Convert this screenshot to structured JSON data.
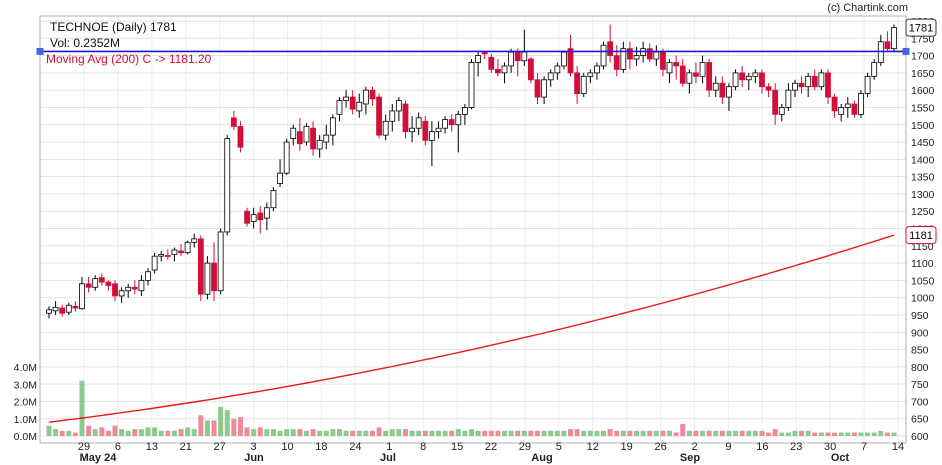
{
  "watermark": "(c) Chartink.com",
  "header": {
    "title": "TECHNOE (Daily) 1781",
    "volume": "Vol: 0.2352M",
    "ma_label": "Moving Avg (200) C -> 1181.20"
  },
  "badges": {
    "last": "1781",
    "ma": "1181"
  },
  "colors": {
    "up": "#ffffff",
    "up_border": "#000000",
    "down": "#d0103a",
    "ma": "#e81c1c",
    "hline": "#1a1ad0",
    "vol_up": "#8ec98e",
    "vol_down": "#ef8a9a",
    "grid": "#e3e3e3"
  },
  "chart_data": {
    "type": "candlestick",
    "title": "TECHNOE (Daily) 1781",
    "price_axis": {
      "min": 600,
      "max": 1800,
      "step": 50,
      "labels": [
        "600",
        "650",
        "700",
        "750",
        "800",
        "850",
        "900",
        "950",
        "1000",
        "1050",
        "1100",
        "1150",
        "1200",
        "1250",
        "1300",
        "1350",
        "1400",
        "1450",
        "1500",
        "1550",
        "1600",
        "1650",
        "1700",
        "1750",
        "1800"
      ]
    },
    "volume_axis": {
      "labels": [
        "0.0M",
        "1.0M",
        "2.0M",
        "3.0M",
        "4.0M"
      ],
      "max": 4.0
    },
    "horizontal_line": 1712,
    "moving_average": {
      "name": "Moving Avg (200) C",
      "last_value": 1181.2,
      "start": 640,
      "end": 1181
    },
    "x_ticks": [
      "29",
      "6",
      "13",
      "21",
      "27",
      "3",
      "10",
      "18",
      "24",
      "1",
      "8",
      "15",
      "22",
      "29",
      "5",
      "12",
      "19",
      "26",
      "2",
      "9",
      "16",
      "23",
      "30",
      "7",
      "14"
    ],
    "month_labels": [
      "May 24",
      "Jun",
      "Jul",
      "Aug",
      "Sep",
      "Oct"
    ],
    "candles": [
      [
        955,
        975,
        940,
        965,
        0.6
      ],
      [
        962,
        990,
        950,
        972,
        0.4
      ],
      [
        970,
        980,
        945,
        955,
        0.3
      ],
      [
        958,
        985,
        950,
        978,
        0.3
      ],
      [
        975,
        990,
        960,
        970,
        0.2
      ],
      [
        968,
        1060,
        965,
        1040,
        3.2
      ],
      [
        1040,
        1060,
        1015,
        1030,
        0.6
      ],
      [
        1030,
        1065,
        1020,
        1055,
        0.4
      ],
      [
        1058,
        1070,
        1035,
        1045,
        0.5
      ],
      [
        1045,
        1050,
        1020,
        1035,
        0.3
      ],
      [
        1040,
        1050,
        990,
        1005,
        0.6
      ],
      [
        1005,
        1030,
        985,
        1020,
        0.4
      ],
      [
        1020,
        1040,
        1000,
        1030,
        0.3
      ],
      [
        1030,
        1050,
        1010,
        1025,
        0.4
      ],
      [
        1020,
        1065,
        1005,
        1050,
        0.4
      ],
      [
        1050,
        1085,
        1035,
        1075,
        0.5
      ],
      [
        1080,
        1130,
        1070,
        1120,
        0.5
      ],
      [
        1120,
        1135,
        1105,
        1125,
        0.3
      ],
      [
        1122,
        1140,
        1110,
        1120,
        0.3
      ],
      [
        1125,
        1145,
        1105,
        1138,
        0.3
      ],
      [
        1135,
        1155,
        1120,
        1130,
        0.4
      ],
      [
        1130,
        1165,
        1125,
        1160,
        0.5
      ],
      [
        1160,
        1185,
        1145,
        1170,
        0.4
      ],
      [
        1170,
        1180,
        990,
        1010,
        1.2
      ],
      [
        1010,
        1120,
        995,
        1100,
        0.9
      ],
      [
        1100,
        1160,
        990,
        1020,
        0.9
      ],
      [
        1020,
        1200,
        1010,
        1190,
        1.7
      ],
      [
        1190,
        1470,
        1180,
        1460,
        1.5
      ],
      [
        1520,
        1540,
        1485,
        1495,
        1.0
      ],
      [
        1495,
        1510,
        1420,
        1435,
        1.1
      ],
      [
        1250,
        1260,
        1205,
        1215,
        0.5
      ],
      [
        1220,
        1260,
        1200,
        1240,
        0.4
      ],
      [
        1245,
        1265,
        1185,
        1225,
        0.5
      ],
      [
        1230,
        1275,
        1195,
        1260,
        0.4
      ],
      [
        1260,
        1320,
        1250,
        1310,
        0.4
      ],
      [
        1330,
        1400,
        1320,
        1360,
        0.3
      ],
      [
        1360,
        1460,
        1355,
        1450,
        0.4
      ],
      [
        1460,
        1500,
        1440,
        1490,
        0.4
      ],
      [
        1480,
        1520,
        1425,
        1445,
        0.4
      ],
      [
        1450,
        1505,
        1440,
        1495,
        0.3
      ],
      [
        1490,
        1510,
        1410,
        1430,
        0.4
      ],
      [
        1430,
        1470,
        1405,
        1455,
        0.3
      ],
      [
        1450,
        1500,
        1430,
        1470,
        0.3
      ],
      [
        1470,
        1530,
        1440,
        1520,
        0.4
      ],
      [
        1530,
        1580,
        1510,
        1570,
        0.4
      ],
      [
        1570,
        1600,
        1550,
        1580,
        0.3
      ],
      [
        1580,
        1600,
        1530,
        1545,
        0.3
      ],
      [
        1540,
        1590,
        1520,
        1565,
        0.3
      ],
      [
        1560,
        1610,
        1530,
        1600,
        0.3
      ],
      [
        1600,
        1610,
        1555,
        1575,
        0.3
      ],
      [
        1580,
        1590,
        1460,
        1470,
        0.5
      ],
      [
        1470,
        1530,
        1455,
        1510,
        0.3
      ],
      [
        1510,
        1560,
        1480,
        1540,
        0.4
      ],
      [
        1540,
        1580,
        1510,
        1570,
        0.4
      ],
      [
        1560,
        1570,
        1460,
        1480,
        0.4
      ],
      [
        1480,
        1525,
        1450,
        1490,
        0.3
      ],
      [
        1490,
        1535,
        1470,
        1520,
        0.3
      ],
      [
        1510,
        1525,
        1440,
        1455,
        0.3
      ],
      [
        1455,
        1510,
        1380,
        1480,
        0.3
      ],
      [
        1480,
        1510,
        1460,
        1490,
        0.3
      ],
      [
        1490,
        1525,
        1475,
        1515,
        0.3
      ],
      [
        1515,
        1530,
        1480,
        1500,
        0.3
      ],
      [
        1500,
        1540,
        1420,
        1530,
        0.4
      ],
      [
        1530,
        1560,
        1500,
        1550,
        0.3
      ],
      [
        1550,
        1690,
        1545,
        1680,
        0.4
      ],
      [
        1680,
        1710,
        1640,
        1700,
        0.3
      ],
      [
        1710,
        1715,
        1690,
        1705,
        0.3
      ],
      [
        1695,
        1705,
        1650,
        1660,
        0.3
      ],
      [
        1660,
        1690,
        1640,
        1650,
        0.3
      ],
      [
        1650,
        1680,
        1620,
        1670,
        0.3
      ],
      [
        1670,
        1720,
        1650,
        1710,
        0.3
      ],
      [
        1710,
        1720,
        1640,
        1685,
        0.3
      ],
      [
        1685,
        1775,
        1670,
        1710,
        0.3
      ],
      [
        1690,
        1695,
        1620,
        1630,
        0.3
      ],
      [
        1630,
        1650,
        1560,
        1580,
        0.3
      ],
      [
        1580,
        1640,
        1560,
        1630,
        0.3
      ],
      [
        1630,
        1660,
        1610,
        1650,
        0.3
      ],
      [
        1650,
        1680,
        1630,
        1670,
        0.3
      ],
      [
        1670,
        1715,
        1660,
        1710,
        0.3
      ],
      [
        1720,
        1760,
        1640,
        1650,
        0.4
      ],
      [
        1650,
        1670,
        1560,
        1590,
        0.4
      ],
      [
        1590,
        1650,
        1580,
        1640,
        0.3
      ],
      [
        1640,
        1660,
        1620,
        1650,
        0.3
      ],
      [
        1650,
        1680,
        1630,
        1670,
        0.3
      ],
      [
        1670,
        1740,
        1660,
        1730,
        0.3
      ],
      [
        1740,
        1790,
        1680,
        1700,
        0.4
      ],
      [
        1700,
        1730,
        1640,
        1660,
        0.3
      ],
      [
        1660,
        1740,
        1650,
        1720,
        0.3
      ],
      [
        1720,
        1740,
        1660,
        1690,
        0.3
      ],
      [
        1690,
        1725,
        1670,
        1700,
        0.3
      ],
      [
        1700,
        1740,
        1680,
        1720,
        0.3
      ],
      [
        1720,
        1735,
        1680,
        1690,
        0.3
      ],
      [
        1690,
        1730,
        1670,
        1710,
        0.3
      ],
      [
        1710,
        1720,
        1640,
        1660,
        0.3
      ],
      [
        1650,
        1690,
        1620,
        1680,
        0.3
      ],
      [
        1680,
        1700,
        1630,
        1670,
        0.2
      ],
      [
        1670,
        1690,
        1610,
        1620,
        0.7
      ],
      [
        1620,
        1660,
        1590,
        1650,
        0.3
      ],
      [
        1650,
        1680,
        1620,
        1640,
        0.3
      ],
      [
        1640,
        1700,
        1620,
        1680,
        0.3
      ],
      [
        1680,
        1690,
        1580,
        1600,
        0.3
      ],
      [
        1600,
        1640,
        1580,
        1620,
        0.3
      ],
      [
        1620,
        1640,
        1560,
        1580,
        0.3
      ],
      [
        1580,
        1620,
        1540,
        1610,
        0.3
      ],
      [
        1610,
        1660,
        1600,
        1650,
        0.3
      ],
      [
        1650,
        1670,
        1610,
        1630,
        0.3
      ],
      [
        1630,
        1650,
        1600,
        1640,
        0.3
      ],
      [
        1640,
        1660,
        1620,
        1650,
        0.3
      ],
      [
        1650,
        1660,
        1590,
        1610,
        0.3
      ],
      [
        1610,
        1620,
        1580,
        1600,
        0.2
      ],
      [
        1600,
        1620,
        1500,
        1530,
        0.4
      ],
      [
        1530,
        1560,
        1510,
        1550,
        0.2
      ],
      [
        1550,
        1620,
        1540,
        1600,
        0.2
      ],
      [
        1600,
        1630,
        1580,
        1620,
        0.3
      ],
      [
        1620,
        1640,
        1590,
        1610,
        0.3
      ],
      [
        1610,
        1650,
        1580,
        1640,
        0.3
      ],
      [
        1640,
        1660,
        1600,
        1610,
        0.2
      ],
      [
        1610,
        1660,
        1600,
        1650,
        0.2
      ],
      [
        1650,
        1660,
        1560,
        1580,
        0.2
      ],
      [
        1580,
        1590,
        1520,
        1540,
        0.2
      ],
      [
        1530,
        1560,
        1510,
        1550,
        0.2
      ],
      [
        1550,
        1580,
        1520,
        1560,
        0.2
      ],
      [
        1560,
        1570,
        1520,
        1530,
        0.2
      ],
      [
        1530,
        1600,
        1520,
        1590,
        0.2
      ],
      [
        1590,
        1650,
        1580,
        1640,
        0.2
      ],
      [
        1640,
        1690,
        1630,
        1680,
        0.2
      ],
      [
        1680,
        1760,
        1670,
        1740,
        0.3
      ],
      [
        1740,
        1770,
        1710,
        1720,
        0.2
      ],
      [
        1720,
        1790,
        1710,
        1781,
        0.2
      ]
    ]
  }
}
